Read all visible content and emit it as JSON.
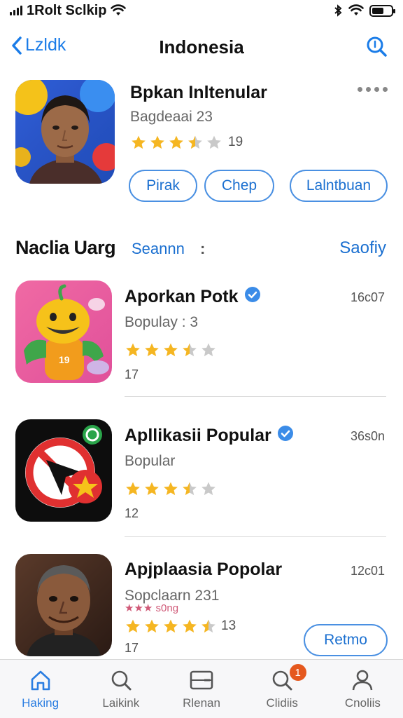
{
  "status_bar": {
    "carrier": "1Rolt Sclkip"
  },
  "nav": {
    "back_label": "Lzldk",
    "title": "Indonesia"
  },
  "featured": {
    "title": "Bpkan Inltenular",
    "subtitle": "Bagdeaai 23",
    "rating": 3.5,
    "rating_text": "19",
    "buttons": [
      "Pirak",
      "Chep",
      "Lalntbuan"
    ]
  },
  "section": {
    "title": "Naclia Uarg",
    "tag": "Seannn",
    "dots": ":",
    "link": "Saofiy"
  },
  "apps": [
    {
      "name": "Aporkan Potk",
      "verified": true,
      "size": "16c07",
      "subtitle": "Bopulay : 3",
      "rating": 3.5,
      "count": "17"
    },
    {
      "name": "Apllikasii Popular",
      "verified": true,
      "size": "36s0n",
      "subtitle": "Bopular",
      "rating": 3.5,
      "count": "12"
    },
    {
      "name": "Apjplaasia Popolar",
      "verified": false,
      "size": "12c01",
      "subtitle": "Sopclaarn 231",
      "extra": "★★★ s0ng",
      "rating": 4.5,
      "rating_text": "13",
      "count": "17"
    }
  ],
  "action_button": "Retmo",
  "tabs": [
    {
      "label": "Haking",
      "icon": "home-icon",
      "active": true
    },
    {
      "label": "Laikink",
      "icon": "search-icon",
      "active": false
    },
    {
      "label": "Rlenan",
      "icon": "card-icon",
      "active": false
    },
    {
      "label": "Clidiis",
      "icon": "search-icon",
      "active": false,
      "badge": "1"
    },
    {
      "label": "Cnoliis",
      "icon": "person-icon",
      "active": false
    }
  ],
  "colors": {
    "accent": "#1a7ce8",
    "star": "#f5b622",
    "badge": "#e5581e",
    "verified": "#3b8ce8"
  }
}
